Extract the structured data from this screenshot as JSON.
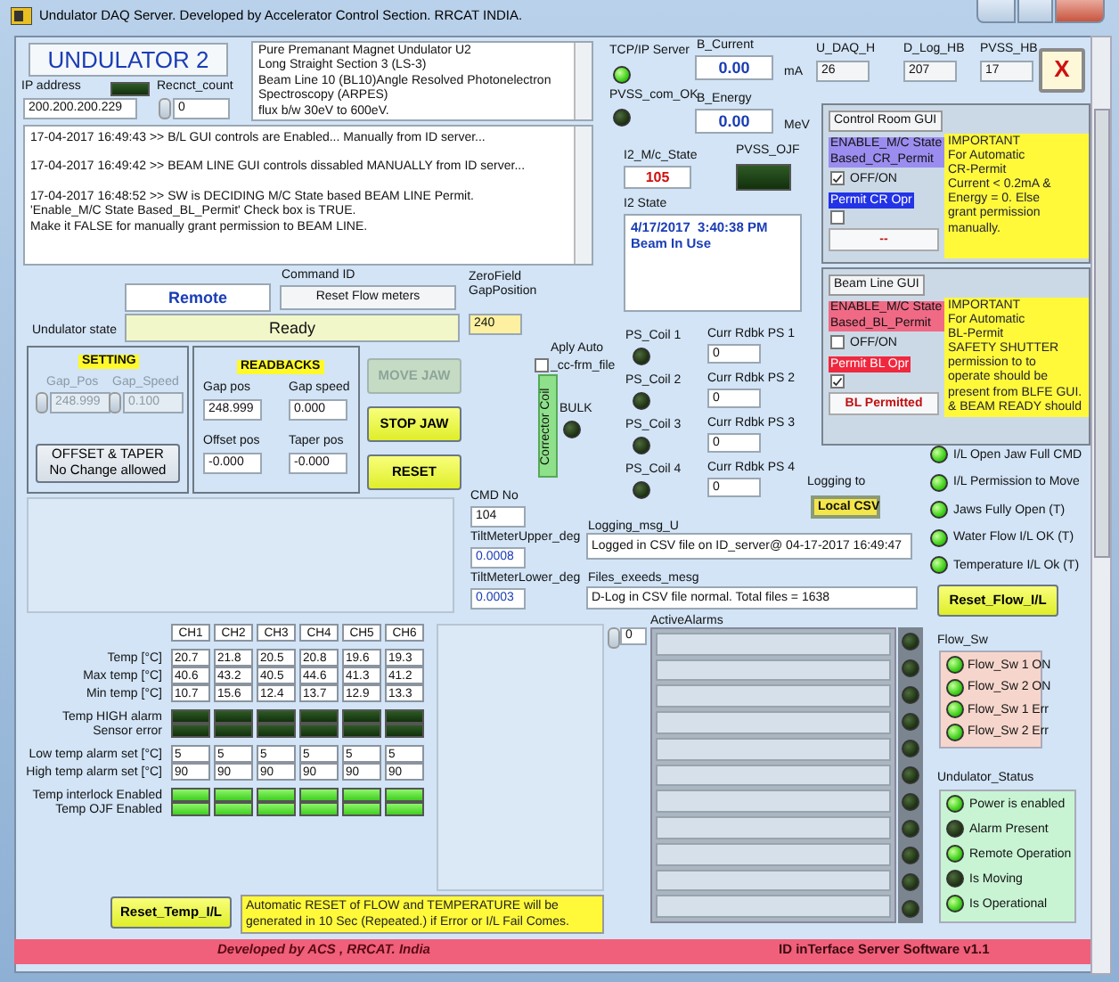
{
  "window": {
    "title": "Undulator DAQ Server. Developed by Accelerator Control Section. RRCAT INDIA."
  },
  "header": {
    "name": "UNDULATOR 2",
    "ip_label": "IP address",
    "ip_value": "200.200.200.229",
    "ip_led_on": false,
    "reconnect_label": "Recnct_count",
    "reconnect_value": "0"
  },
  "description": [
    "Pure Premanant Magnet Undulator U2",
    "Long Straight Section 3 (LS-3)",
    "Beam Line 10 (BL10)Angle Resolved Photonelectron",
    "Spectroscopy (ARPES)",
    "flux b/w 30eV to 600eV."
  ],
  "log": [
    [
      "17-04-2017 16:49:43 >> B/L GUI controls are Enabled... Manually from ID server..."
    ],
    [
      "17-04-2017 16:49:42 >> BEAM LINE GUI controls dissabled MANUALLY from ID server..."
    ],
    [
      "17-04-2017 16:48:52 >> SW is DECIDING M/C State based BEAM LINE Permit.",
      "'Enable_M/C State Based_BL_Permit' Check box is TRUE.",
      "Make it FALSE for manually grant permission to BEAM LINE."
    ]
  ],
  "command": {
    "mode": "Remote",
    "command_id_label": "Command ID",
    "command_id": "Reset Flow meters",
    "state_label": "Undulator state",
    "state": "Ready",
    "zero_label": [
      "ZeroField",
      "GapPosition"
    ],
    "zero_value": "240"
  },
  "setting": {
    "title": "SETTING",
    "disabled": true,
    "fields": [
      {
        "label": "Gap_Pos",
        "value": "248.999"
      },
      {
        "label": "Gap_Speed",
        "value": "0.100"
      }
    ],
    "offset_button": [
      "OFFSET & TAPER",
      "No Change allowed"
    ]
  },
  "readbacks": {
    "title": "READBACKS",
    "fields": [
      {
        "label": "Gap pos",
        "value": "248.999"
      },
      {
        "label": "Gap speed",
        "value": "0.000"
      },
      {
        "label": "Offset pos",
        "value": "-0.000"
      },
      {
        "label": "Taper pos",
        "value": "-0.000"
      }
    ]
  },
  "jaw_buttons": [
    {
      "label": "MOVE JAW",
      "disabled": true
    },
    {
      "label": "STOP JAW",
      "disabled": false
    },
    {
      "label": "RESET",
      "disabled": false
    }
  ],
  "auto_file": {
    "label": [
      "Aply Auto",
      "_cc-frm_file"
    ],
    "checked": false
  },
  "corrector": {
    "label": "Corrector Coil",
    "bulk_label": "BULK",
    "bulk_on": false,
    "coils": [
      {
        "label": "PS_Coil 1",
        "on": false,
        "readback_label": "Curr Rdbk PS 1",
        "readback": "0"
      },
      {
        "label": "PS_Coil 2",
        "on": false,
        "readback_label": "Curr Rdbk PS 2",
        "readback": "0"
      },
      {
        "label": "PS_Coil 3",
        "on": false,
        "readback_label": "Curr Rdbk PS 3",
        "readback": "0"
      },
      {
        "label": "PS_Coil 4",
        "on": false,
        "readback_label": "Curr Rdbk PS 4",
        "readback": "0"
      }
    ]
  },
  "cmd": {
    "cmd_no_label": "CMD No",
    "cmd_no": "104",
    "tilt_upper_label": "TiltMeterUpper_deg",
    "tilt_upper": "0.0008",
    "tilt_lower_label": "TiltMeterLower_deg",
    "tilt_lower": "0.0003"
  },
  "top_status": {
    "tcp_label": "TCP/IP Server",
    "tcp_on": true,
    "pvss_label": "PVSS_com_OK",
    "pvss_on": false,
    "b_current_label": "B_Current",
    "b_current": "0.00",
    "b_current_unit": "mA",
    "b_energy_label": "B_Energy",
    "b_energy": "0.00",
    "b_energy_unit": "MeV"
  },
  "heartbeats": [
    {
      "label": "U_DAQ_H",
      "value": "26"
    },
    {
      "label": "D_Log_HB",
      "value": "207"
    },
    {
      "label": "PVSS_HB",
      "value": "17"
    }
  ],
  "close_button": "X",
  "i2": {
    "mc_state_label": "I2_M/c_State",
    "mc_state": "105",
    "ojf_label": "PVSS_OJF",
    "ojf_on": false,
    "state_label": "I2 State",
    "state_lines": [
      "4/17/2017  3:40:38 PM",
      "Beam In Use"
    ]
  },
  "permits": [
    {
      "title": "Control Room GUI",
      "enable_label": [
        "ENABLE_M/C State",
        "Based_CR_Permit"
      ],
      "enable_checked": true,
      "enable_text": "OFF/ON",
      "permit_label": "Permit CR Opr",
      "permit_checked": false,
      "status": "--",
      "note": [
        "IMPORTANT",
        "For Automatic",
        "CR-Permit",
        "Current < 0.2mA  &",
        " Energy = 0. Else",
        "grant permission",
        "manually."
      ]
    },
    {
      "title": "Beam Line GUI",
      "enable_label": [
        "ENABLE_M/C State",
        "Based_BL_Permit"
      ],
      "enable_checked": false,
      "enable_text": "OFF/ON",
      "permit_label": "Permit BL Opr",
      "permit_checked": true,
      "status": "BL Permitted",
      "note": [
        "IMPORTANT",
        "For Automatic",
        "BL-Permit",
        "SAFETY SHUTTER",
        "permission to to",
        "operate should be",
        "present from BLFE GUI.",
        "& BEAM READY should"
      ]
    }
  ],
  "logging": {
    "to_label": "Logging to",
    "to_value": "Local CSV",
    "msg_label": "Logging_msg_U",
    "msg": "Logged in CSV file on ID_server@ 04-17-2017 16:49:47",
    "files_label": "Files_exeeds_mesg",
    "files": "D-Log in CSV file normal. Total files = 1638"
  },
  "interlocks": [
    {
      "label": "I/L Open Jaw Full CMD",
      "on": true
    },
    {
      "label": "I/L Permission to Move",
      "on": true
    },
    {
      "label": "Jaws Fully Open (T)",
      "on": true
    },
    {
      "label": "Water Flow I/L OK (T)",
      "on": true
    },
    {
      "label": "Temperature I/L Ok (T)",
      "on": true
    }
  ],
  "reset_flow_button": "Reset_Flow_I/L",
  "alarms": {
    "label": "ActiveAlarms",
    "index": "0",
    "slots": [
      {
        "on": false
      },
      {
        "on": false
      },
      {
        "on": false
      },
      {
        "on": false
      },
      {
        "on": false
      },
      {
        "on": false
      },
      {
        "on": false
      },
      {
        "on": false
      },
      {
        "on": false
      },
      {
        "on": false
      },
      {
        "on": false
      }
    ]
  },
  "flow_sw": {
    "label": "Flow_Sw",
    "items": [
      {
        "label": "Flow_Sw 1 ON",
        "on": true
      },
      {
        "label": "Flow_Sw 2 ON",
        "on": true
      },
      {
        "label": "Flow_Sw 1 Err",
        "on": true
      },
      {
        "label": "Flow_Sw 2 Err",
        "on": true
      }
    ]
  },
  "undulator_status": {
    "label": "Undulator_Status",
    "items": [
      {
        "label": "Power is enabled",
        "on": true
      },
      {
        "label": "Alarm Present",
        "on": false
      },
      {
        "label": "Remote Operation",
        "on": true
      },
      {
        "label": "Is Moving",
        "on": false
      },
      {
        "label": "Is Operational",
        "on": true
      }
    ]
  },
  "temperature": {
    "channels": [
      "CH1",
      "CH2",
      "CH3",
      "CH4",
      "CH5",
      "CH6"
    ],
    "groups": [
      {
        "rows": [
          {
            "kind": "values",
            "label": "Temp [°C]",
            "values": [
              "20.7",
              "21.8",
              "20.5",
              "20.8",
              "19.6",
              "19.3"
            ]
          },
          {
            "kind": "values",
            "label": "Max temp [°C]",
            "values": [
              "40.6",
              "43.2",
              "40.5",
              "44.6",
              "41.3",
              "41.2"
            ]
          },
          {
            "kind": "values",
            "label": "Min temp [°C]",
            "values": [
              "10.7",
              "15.6",
              "12.4",
              "13.7",
              "12.9",
              "13.3"
            ]
          }
        ]
      },
      {
        "rows": [
          {
            "kind": "leds",
            "label": "Temp HIGH alarm",
            "leds": [
              false,
              false,
              false,
              false,
              false,
              false
            ]
          },
          {
            "kind": "leds",
            "label": "Sensor error",
            "leds": [
              false,
              false,
              false,
              false,
              false,
              false
            ]
          }
        ]
      },
      {
        "rows": [
          {
            "kind": "values",
            "label": "Low temp alarm set [°C]",
            "values": [
              "5",
              "5",
              "5",
              "5",
              "5",
              "5"
            ]
          },
          {
            "kind": "values",
            "label": "High temp alarm set [°C]",
            "values": [
              "90",
              "90",
              "90",
              "90",
              "90",
              "90"
            ]
          }
        ]
      },
      {
        "rows": [
          {
            "kind": "leds",
            "label": "Temp interlock Enabled",
            "leds": [
              true,
              true,
              true,
              true,
              true,
              true
            ]
          },
          {
            "kind": "leds",
            "label": "Temp OJF Enabled",
            "leds": [
              true,
              true,
              true,
              true,
              true,
              true
            ]
          }
        ]
      }
    ]
  },
  "reset_temp_button": "Reset_Temp_I/L",
  "auto_reset_note": "Automatic RESET of FLOW and TEMPERATURE will be generated in 10 Sec (Repeated.)  if Error or I/L Fail Comes.",
  "footer": {
    "left": "Developed by ACS , RRCAT. India",
    "right": "ID inTerface Server Software v1.1"
  }
}
